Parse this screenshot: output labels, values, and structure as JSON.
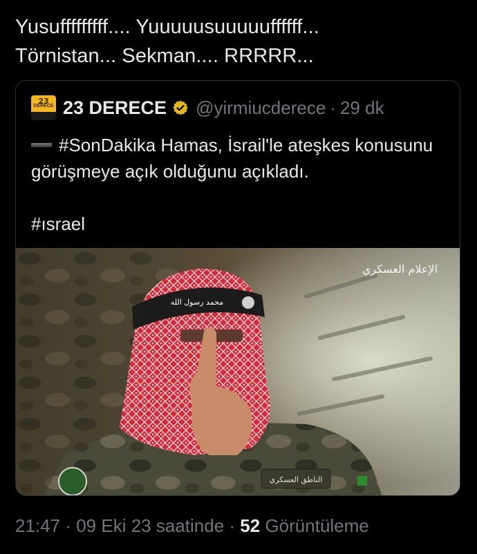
{
  "tweet": {
    "text": "Yusufffffffff.... Yuuuuusuuuuuffffff...\nTörnistan... Sekman.... RRRRR..."
  },
  "quote": {
    "avatar": {
      "number": "23",
      "word": "DERECE"
    },
    "display_name": "23 DERECE",
    "handle": "@yirmiucderece",
    "separator": "·",
    "time": "29 dk",
    "body_line": "#SonDakika Hamas, İsrail'le ateşkes konusunu görüşmeye açık olduğunu açıkladı.",
    "hashtag": "#ısrael",
    "media": {
      "watermark": "الإعلام العسكري",
      "headband_text": "محمد رسول الله",
      "patch_text": "الناطق العسكري"
    }
  },
  "footer": {
    "time": "21:47",
    "sep1": "·",
    "date": "09 Eki 23 saatinde",
    "sep2": "·",
    "views_count": "52",
    "views_label": "Görüntüleme"
  },
  "colors": {
    "background": "#000000",
    "text": "#e7e9ea",
    "muted": "#71767b",
    "border": "#2f3336",
    "verified": "#e2b719"
  }
}
